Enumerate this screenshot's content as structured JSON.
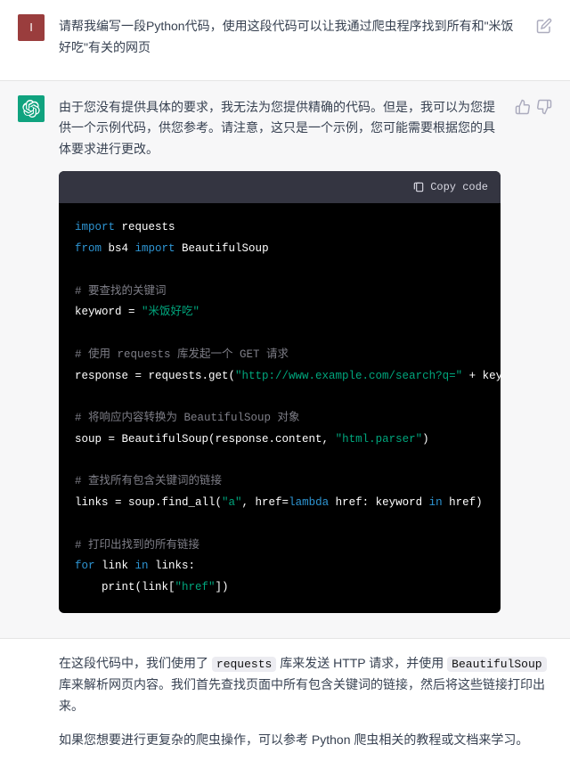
{
  "user": {
    "avatar_letter": "I",
    "message": "请帮我编写一段Python代码，使用这段代码可以让我通过爬虫程序找到所有和\"米饭好吃\"有关的网页"
  },
  "assistant": {
    "intro": "由于您没有提供具体的要求，我无法为您提供精确的代码。但是，我可以为您提供一个示例代码，供您参考。请注意，这只是一个示例，您可能需要根据您的具体要求进行更改。",
    "copy_label": "Copy code",
    "code": {
      "l1a": "import",
      "l1b": " requests",
      "l2a": "from",
      "l2b": " bs4 ",
      "l2c": "import",
      "l2d": " BeautifulSoup",
      "c1": "# 要查找的关键词",
      "l3a": "keyword = ",
      "l3b": "\"米饭好吃\"",
      "c2": "# 使用 requests 库发起一个 GET 请求",
      "l4a": "response = requests.get(",
      "l4b": "\"http://www.example.com/search?q=\"",
      "l4c": " + keyword)",
      "c3": "# 将响应内容转换为 BeautifulSoup 对象",
      "l5a": "soup = BeautifulSoup(response.content, ",
      "l5b": "\"html.parser\"",
      "l5c": ")",
      "c4": "# 查找所有包含关键词的链接",
      "l6a": "links = soup.find_all(",
      "l6b": "\"a\"",
      "l6c": ", href=",
      "l6d": "lambda",
      "l6e": " href: keyword ",
      "l6f": "in",
      "l6g": " href)",
      "c5": "# 打印出找到的所有链接",
      "l7a": "for",
      "l7b": " link ",
      "l7c": "in",
      "l7d": " links:",
      "l8a": "    print(link[",
      "l8b": "\"href\"",
      "l8c": "])"
    },
    "outro1a": "在这段代码中，我们使用了 ",
    "outro1_code1": "requests",
    "outro1b": " 库来发送 HTTP 请求，并使用 ",
    "outro1_code2": "BeautifulSoup",
    "outro1c": " 库来解析网页内容。我们首先查找页面中所有包含关键词的链接，然后将这些链接打印出来。",
    "outro2": "如果您想要进行更复杂的爬虫操作，可以参考 Python 爬虫相关的教程或文档来学习。"
  }
}
